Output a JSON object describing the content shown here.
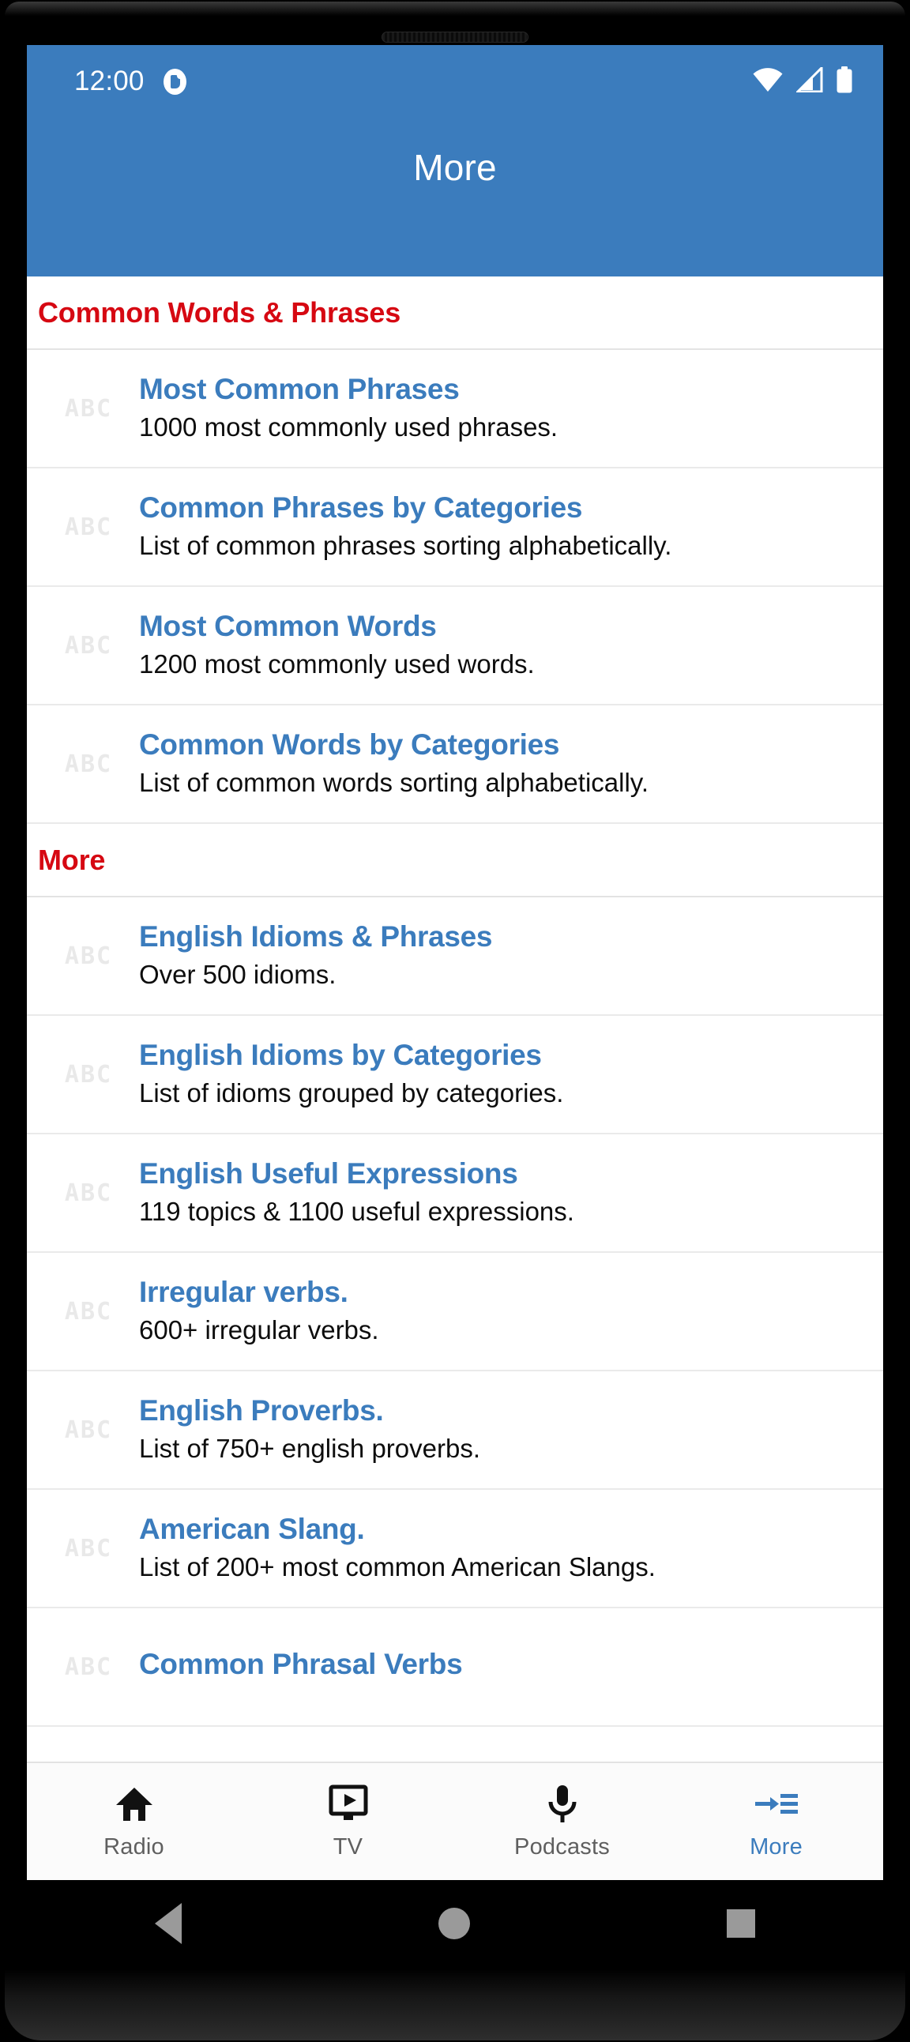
{
  "statusbar": {
    "clock": "12:00",
    "icons": [
      "alarm-icon",
      "wifi-icon",
      "cellular-signal-icon",
      "battery-icon"
    ]
  },
  "appbar": {
    "title": "More",
    "background_color": "#3b7cbd",
    "title_color": "#ffffff"
  },
  "colors": {
    "accent_blue": "#3b7cbd",
    "section_red": "#d60812",
    "icon_gray": "#e9e9e9",
    "subtitle_black": "#0d0d0d"
  },
  "row_icon_label": "ABC",
  "sections": [
    {
      "header": "Common Words & Phrases",
      "items": [
        {
          "title": "Most Common Phrases",
          "subtitle": "1000 most commonly used phrases."
        },
        {
          "title": "Common Phrases by Categories",
          "subtitle": "List of common phrases sorting alphabetically."
        },
        {
          "title": "Most Common Words",
          "subtitle": "1200 most commonly used words."
        },
        {
          "title": "Common Words by Categories",
          "subtitle": "List of common words sorting alphabetically."
        }
      ]
    },
    {
      "header": "More",
      "items": [
        {
          "title": "English Idioms & Phrases",
          "subtitle": "Over 500 idioms."
        },
        {
          "title": "English Idioms by Categories",
          "subtitle": "List of idioms grouped by categories."
        },
        {
          "title": "English Useful Expressions",
          "subtitle": "119 topics & 1100 useful expressions."
        },
        {
          "title": "Irregular verbs.",
          "subtitle": "600+ irregular verbs."
        },
        {
          "title": "English Proverbs.",
          "subtitle": "List of 750+ english proverbs."
        },
        {
          "title": "American Slang.",
          "subtitle": "List of 200+ most common American Slangs."
        },
        {
          "title": "Common Phrasal Verbs",
          "subtitle": ""
        }
      ]
    }
  ],
  "tabbar": {
    "tabs": [
      {
        "label": "Radio",
        "icon": "home-icon",
        "active": false
      },
      {
        "label": "TV",
        "icon": "tv-icon",
        "active": false
      },
      {
        "label": "Podcasts",
        "icon": "microphone-icon",
        "active": false
      },
      {
        "label": "More",
        "icon": "arrow-into-list-icon",
        "active": true
      }
    ]
  },
  "navbar": {
    "buttons": [
      "back-button",
      "home-button",
      "recents-button"
    ]
  }
}
